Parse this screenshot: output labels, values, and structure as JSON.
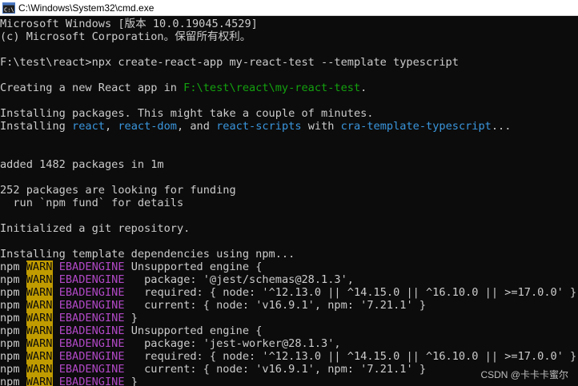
{
  "window": {
    "title": "C:\\Windows\\System32\\cmd.exe",
    "icon": "cmd-icon"
  },
  "watermark": "CSDN @卡卡卡蜜尔",
  "colors": {
    "background": "#0c0c0c",
    "text": "#cccccc",
    "path_green": "#13a10e",
    "package_blue": "#3a96dd",
    "warn_bg": "#c19c00",
    "code_purple": "#b148c6"
  },
  "console": {
    "lines": [
      [
        {
          "t": "Microsoft Windows [版本 10.0.19045.4529]",
          "c": "plain"
        }
      ],
      [
        {
          "t": "(c) Microsoft Corporation。保留所有权利。",
          "c": "plain"
        }
      ],
      [],
      [
        {
          "t": "F:\\test\\react>npx create-react-app my-react-test --template typescript",
          "c": "plain"
        }
      ],
      [],
      [
        {
          "t": "Creating a new React app in ",
          "c": "plain"
        },
        {
          "t": "F:\\test\\react\\my-react-test",
          "c": "green"
        },
        {
          "t": ".",
          "c": "plain"
        }
      ],
      [],
      [
        {
          "t": "Installing packages. This might take a couple of minutes.",
          "c": "plain"
        }
      ],
      [
        {
          "t": "Installing ",
          "c": "plain"
        },
        {
          "t": "react",
          "c": "cyan"
        },
        {
          "t": ", ",
          "c": "plain"
        },
        {
          "t": "react-dom",
          "c": "cyan"
        },
        {
          "t": ", and ",
          "c": "plain"
        },
        {
          "t": "react-scripts",
          "c": "cyan"
        },
        {
          "t": " with ",
          "c": "plain"
        },
        {
          "t": "cra-template-typescript",
          "c": "cyan"
        },
        {
          "t": "...",
          "c": "plain"
        }
      ],
      [],
      [],
      [
        {
          "t": "added 1482 packages in 1m",
          "c": "plain"
        }
      ],
      [],
      [
        {
          "t": "252 packages are looking for funding",
          "c": "plain"
        }
      ],
      [
        {
          "t": "  run `npm fund` for details",
          "c": "plain"
        }
      ],
      [],
      [
        {
          "t": "Initialized a git repository.",
          "c": "plain"
        }
      ],
      [],
      [
        {
          "t": "Installing template dependencies using npm...",
          "c": "plain"
        }
      ],
      [
        {
          "t": "npm ",
          "c": "plain"
        },
        {
          "t": "WARN",
          "c": "warn"
        },
        {
          "t": " ",
          "c": "plain"
        },
        {
          "t": "EBADENGINE",
          "c": "purple"
        },
        {
          "t": " Unsupported engine {",
          "c": "plain"
        }
      ],
      [
        {
          "t": "npm ",
          "c": "plain"
        },
        {
          "t": "WARN",
          "c": "warn"
        },
        {
          "t": " ",
          "c": "plain"
        },
        {
          "t": "EBADENGINE",
          "c": "purple"
        },
        {
          "t": "   package: '@jest/schemas@28.1.3',",
          "c": "plain"
        }
      ],
      [
        {
          "t": "npm ",
          "c": "plain"
        },
        {
          "t": "WARN",
          "c": "warn"
        },
        {
          "t": " ",
          "c": "plain"
        },
        {
          "t": "EBADENGINE",
          "c": "purple"
        },
        {
          "t": "   required: { node: '^12.13.0 || ^14.15.0 || ^16.10.0 || >=17.0.0' },",
          "c": "plain"
        }
      ],
      [
        {
          "t": "npm ",
          "c": "plain"
        },
        {
          "t": "WARN",
          "c": "warn"
        },
        {
          "t": " ",
          "c": "plain"
        },
        {
          "t": "EBADENGINE",
          "c": "purple"
        },
        {
          "t": "   current: { node: 'v16.9.1', npm: '7.21.1' }",
          "c": "plain"
        }
      ],
      [
        {
          "t": "npm ",
          "c": "plain"
        },
        {
          "t": "WARN",
          "c": "warn"
        },
        {
          "t": " ",
          "c": "plain"
        },
        {
          "t": "EBADENGINE",
          "c": "purple"
        },
        {
          "t": " }",
          "c": "plain"
        }
      ],
      [
        {
          "t": "npm ",
          "c": "plain"
        },
        {
          "t": "WARN",
          "c": "warn"
        },
        {
          "t": " ",
          "c": "plain"
        },
        {
          "t": "EBADENGINE",
          "c": "purple"
        },
        {
          "t": " Unsupported engine {",
          "c": "plain"
        }
      ],
      [
        {
          "t": "npm ",
          "c": "plain"
        },
        {
          "t": "WARN",
          "c": "warn"
        },
        {
          "t": " ",
          "c": "plain"
        },
        {
          "t": "EBADENGINE",
          "c": "purple"
        },
        {
          "t": "   package: 'jest-worker@28.1.3',",
          "c": "plain"
        }
      ],
      [
        {
          "t": "npm ",
          "c": "plain"
        },
        {
          "t": "WARN",
          "c": "warn"
        },
        {
          "t": " ",
          "c": "plain"
        },
        {
          "t": "EBADENGINE",
          "c": "purple"
        },
        {
          "t": "   required: { node: '^12.13.0 || ^14.15.0 || ^16.10.0 || >=17.0.0' },",
          "c": "plain"
        }
      ],
      [
        {
          "t": "npm ",
          "c": "plain"
        },
        {
          "t": "WARN",
          "c": "warn"
        },
        {
          "t": " ",
          "c": "plain"
        },
        {
          "t": "EBADENGINE",
          "c": "purple"
        },
        {
          "t": "   current: { node: 'v16.9.1', npm: '7.21.1' }",
          "c": "plain"
        }
      ],
      [
        {
          "t": "npm ",
          "c": "plain"
        },
        {
          "t": "WARN",
          "c": "warn"
        },
        {
          "t": " ",
          "c": "plain"
        },
        {
          "t": "EBADENGINE",
          "c": "purple"
        },
        {
          "t": " }",
          "c": "plain"
        }
      ]
    ]
  }
}
